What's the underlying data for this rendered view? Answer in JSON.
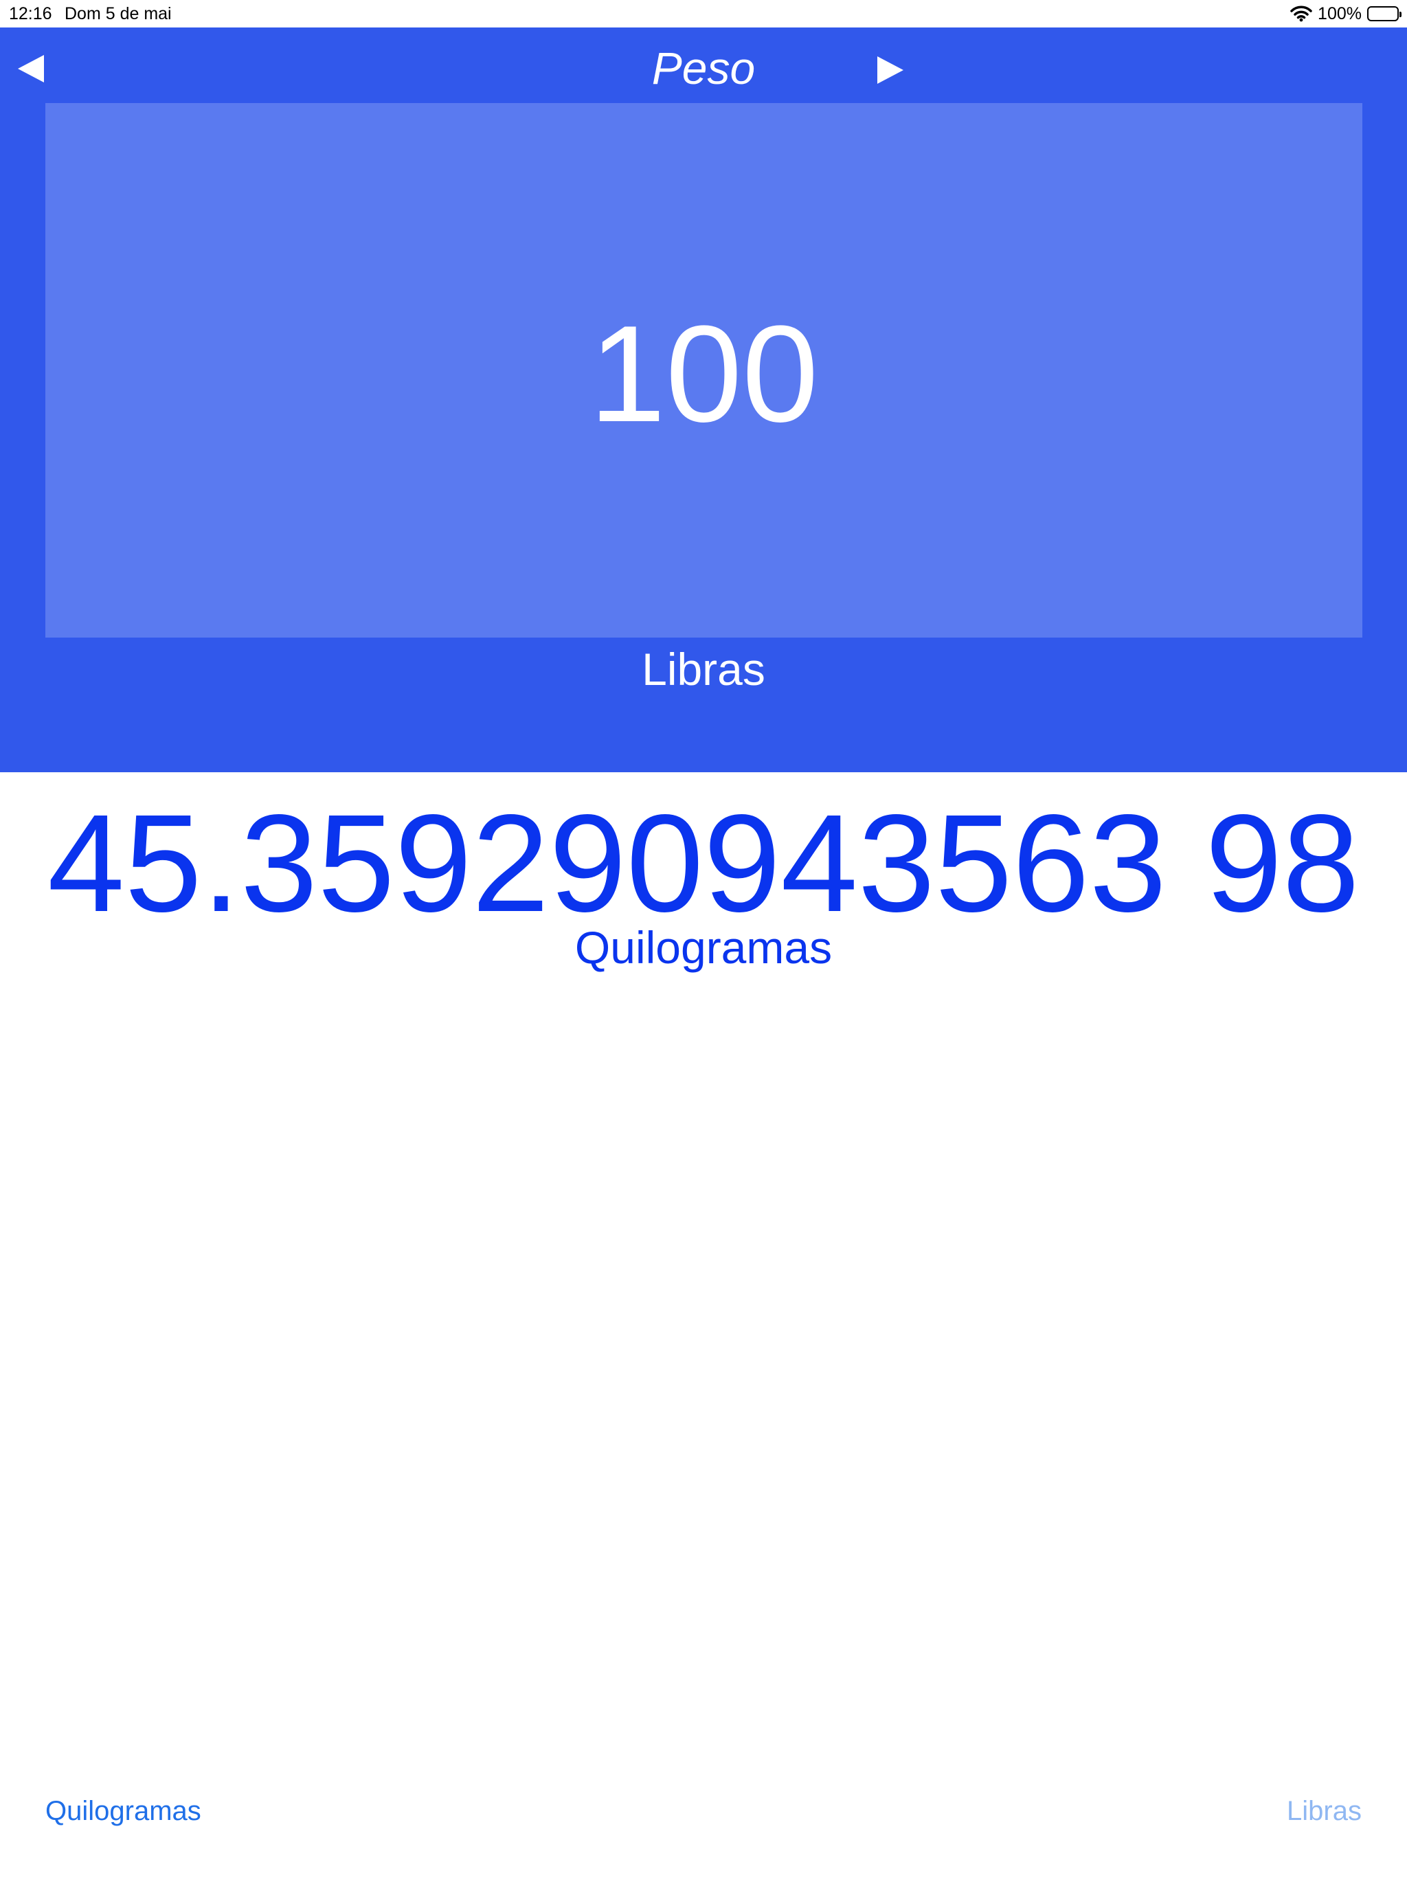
{
  "status_bar": {
    "time": "12:16",
    "date": "Dom 5 de mai",
    "battery_text": "100%",
    "icons": [
      "wifi-icon",
      "battery-icon"
    ]
  },
  "header": {
    "title": "Peso",
    "prev_icon": "triangle-left",
    "next_icon": "triangle-right"
  },
  "converter": {
    "input_value": "100",
    "from_unit": "Libras",
    "result_value": "45.359290943563 98",
    "to_unit": "Quilogramas"
  },
  "bottom": {
    "left_link": "Quilogramas",
    "right_link": "Libras"
  },
  "colors": {
    "panel": "#3158EB",
    "input_box": "#5A7AF0",
    "result_text": "#0A34EE",
    "link": "#1F6FE8",
    "link_disabled": "#8FB7F2"
  }
}
